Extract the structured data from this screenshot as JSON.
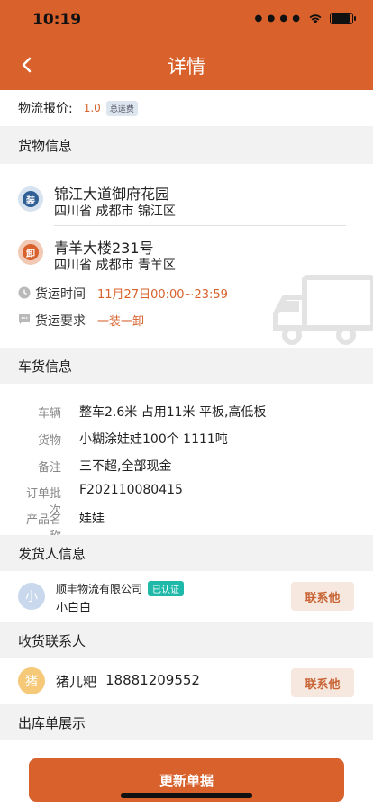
{
  "status_bar": {
    "time": "10:19"
  },
  "header": {
    "title": "详情"
  },
  "quote": {
    "label": "物流报价:",
    "value": "1.0",
    "tag": "总运费"
  },
  "cargo_section": {
    "title": "货物信息"
  },
  "load_address": {
    "badge": "装",
    "name": "锦江大道御府花园",
    "region": "四川省 成都市 锦江区",
    "color": "#6a93c4"
  },
  "unload_address": {
    "badge": "卸",
    "name": "青羊大楼231号",
    "region": "四川省 成都市 青羊区",
    "color": "#e28a5f"
  },
  "ship_time": {
    "label": "货运时间",
    "value": "11月27日00:00~23:59"
  },
  "ship_req": {
    "label": "货运要求",
    "value": "一装一卸"
  },
  "vehicle_section": {
    "title": "车货信息"
  },
  "vehicle_rows": [
    {
      "label": "车辆",
      "value": "整车2.6米 占用11米 平板,高低板"
    },
    {
      "label": "货物",
      "value": "小糊涂娃娃100个 1111吨"
    },
    {
      "label": "备注",
      "value": "三不超,全部现金"
    },
    {
      "label": "订单批次",
      "value": "F202110080415"
    },
    {
      "label": "产品名称",
      "value": "娃娃"
    }
  ],
  "shipper_section": {
    "title": "发货人信息"
  },
  "shipper": {
    "avatar": "小",
    "company": "顺丰物流有限公司",
    "verified": "已认证",
    "name": "小白白",
    "contact": "联系他"
  },
  "receiver_section": {
    "title": "收货联系人"
  },
  "receiver": {
    "avatar": "猪",
    "name": "猪儿粑",
    "phone": "18881209552",
    "contact": "联系他"
  },
  "outbound_section": {
    "title": "出库单展示"
  },
  "bottom_button": {
    "label": "更新单据"
  }
}
